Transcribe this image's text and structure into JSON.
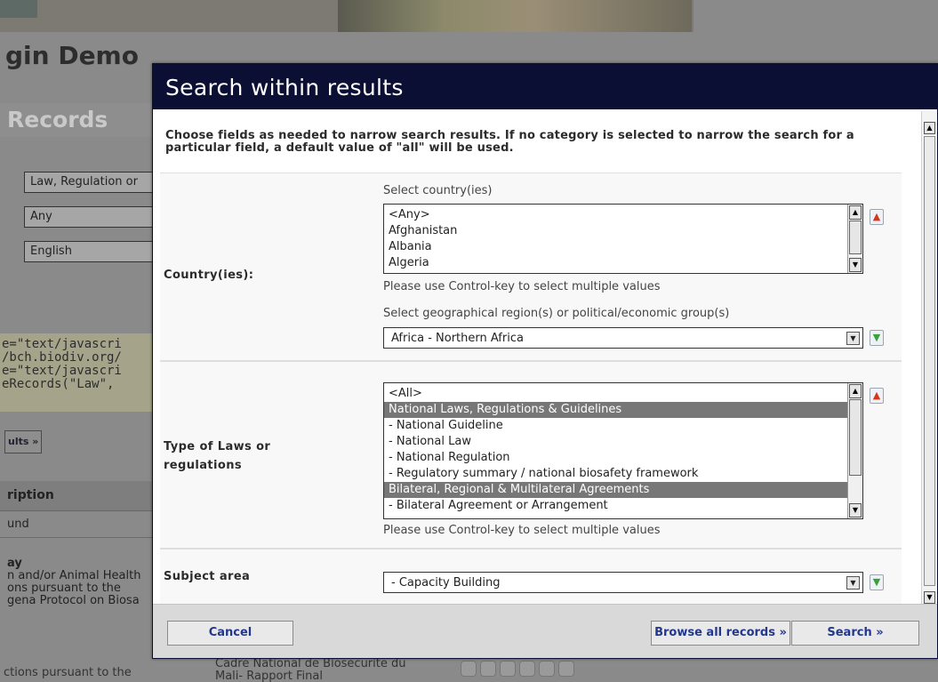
{
  "background": {
    "page_title": "gin Demo",
    "records_heading": "Records",
    "filter_values": [
      "Law, Regulation or",
      "Any",
      "English"
    ],
    "code_lines": [
      "e=\"text/javascri",
      "/bch.biodiv.org/",
      "e=\"text/javascri",
      "eRecords(\"Law\","
    ],
    "results_button": "ults »",
    "table_header": "ription",
    "rows": [
      {
        "text": "und",
        "bold": false
      },
      {
        "text": "ay",
        "bold": true
      },
      {
        "text": "n and/or Animal Health",
        "bold": false
      },
      {
        "text": "ons pursuant to the",
        "bold": false
      },
      {
        "text": "gena Protocol on Biosa",
        "bold": false
      }
    ],
    "lower_left_text": "ctions pursuant to the",
    "lower_mid_text": [
      "Cadre National de Biosecurite du",
      "Mali- Rapport Final"
    ]
  },
  "modal": {
    "title": "Search within results",
    "intro": "Choose fields as needed to narrow search results. If no category is selected to narrow the search for a particular field, a default value of \"all\" will be used.",
    "country": {
      "label": "Country(ies):",
      "caption": "Select country(ies)",
      "options": [
        "<Any>",
        "Afghanistan",
        "Albania",
        "Algeria"
      ],
      "hint": "Please use Control-key to select multiple values",
      "region_caption": "Select geographical region(s) or political/economic group(s)",
      "region_value": "Africa - Northern Africa"
    },
    "law_type": {
      "label_line1": "Type of Laws or",
      "label_line2": "regulations",
      "options": [
        {
          "text": "<All>",
          "group": false
        },
        {
          "text": "National Laws, Regulations & Guidelines",
          "group": true
        },
        {
          "text": " - National Guideline",
          "group": false
        },
        {
          "text": " - National Law",
          "group": false
        },
        {
          "text": " - National Regulation",
          "group": false
        },
        {
          "text": " - Regulatory summary / national biosafety framework",
          "group": false
        },
        {
          "text": "Bilateral, Regional & Multilateral Agreements",
          "group": true
        },
        {
          "text": " - Bilateral Agreement or Arrangement",
          "group": false
        }
      ],
      "hint": "Please use Control-key to select multiple values"
    },
    "subject": {
      "label": "Subject area",
      "value": " - Capacity Building"
    },
    "footer": {
      "cancel": "Cancel",
      "browse": "Browse all records »",
      "search": "Search »"
    }
  },
  "icons": {
    "move_up": "arrow-up-icon",
    "move_down": "arrow-down-icon"
  },
  "colors": {
    "modal_header": "#0b0f33",
    "button_text": "#23388d",
    "group_highlight": "#777777"
  }
}
